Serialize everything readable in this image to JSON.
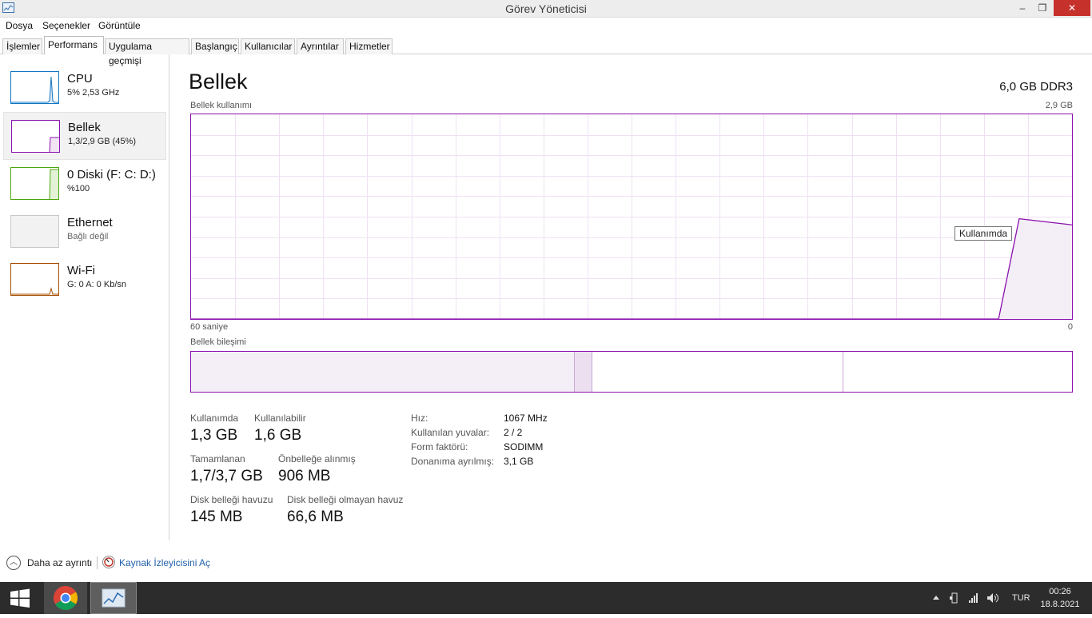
{
  "window": {
    "title": "Görev Yöneticisi",
    "controls": {
      "minimize": "–",
      "maximize": "❐",
      "close": "✕"
    }
  },
  "menu": [
    "Dosya",
    "Seçenekler",
    "Görüntüle"
  ],
  "tabs": [
    "İşlemler",
    "Performans",
    "Uygulama geçmişi",
    "Başlangıç",
    "Kullanıcılar",
    "Ayrıntılar",
    "Hizmetler"
  ],
  "active_tab": "Performans",
  "sidebar": [
    {
      "name": "CPU",
      "sub": "5%  2,53 GHz",
      "color": "#1176c2"
    },
    {
      "name": "Bellek",
      "sub": "1,3/2,9 GB (45%)",
      "color": "#8b12ae"
    },
    {
      "name": "0 Diski (F: C: D:)",
      "sub": "%100",
      "color": "#4da60c"
    },
    {
      "name": "Ethernet",
      "sub": "Bağlı değil",
      "color": "#a7a7a7"
    },
    {
      "name": "Wi-Fi",
      "sub": "G: 0  A: 0 Kb/sn",
      "color": "#a74f01"
    }
  ],
  "memory": {
    "title": "Bellek",
    "spec": "6,0 GB DDR3",
    "usage_label": "Bellek kullanımı",
    "usage_max": "2,9 GB",
    "x_left": "60 saniye",
    "x_right": "0",
    "tooltip": "Kullanımda",
    "composition_label": "Bellek bileşimi",
    "accent": "#8b12ae",
    "stats": [
      {
        "label": "Kullanımda",
        "value": "1,3 GB"
      },
      {
        "label": "Kullanılabilir",
        "value": "1,6 GB"
      },
      {
        "label": "Tamamlanan",
        "value": "1,7/3,7 GB"
      },
      {
        "label": "Önbelleğe alınmış",
        "value": "906 MB"
      },
      {
        "label": "Disk belleği havuzu",
        "value": "145 MB"
      },
      {
        "label": "Disk belleği olmayan havuz",
        "value": "66,6 MB"
      }
    ],
    "details": [
      {
        "key": "Hız:",
        "value": "1067 MHz"
      },
      {
        "key": "Kullanılan yuvalar:",
        "value": "2 / 2"
      },
      {
        "key": "Form faktörü:",
        "value": "SODIMM"
      },
      {
        "key": "Donanıma ayrılmış:",
        "value": "3,1 GB"
      }
    ]
  },
  "chart_data": {
    "type": "area",
    "title": "Bellek kullanımı",
    "xlabel": "",
    "ylabel": "",
    "x": [
      60,
      5,
      3.6,
      0
    ],
    "y_fraction": [
      0,
      0,
      0.49,
      0.46
    ],
    "xlim": [
      60,
      0
    ],
    "ylim": [
      0,
      2.9
    ],
    "grid": true,
    "series": [
      {
        "name": "Kullanımda",
        "values": [
          0,
          0,
          1.42,
          1.33
        ]
      }
    ]
  },
  "composition": {
    "in_use_fraction": 0.436,
    "modified_fraction": 0.02,
    "standby_end_fraction": 0.74
  },
  "footer": {
    "less_details": "Daha az ayrıntı",
    "resource_monitor": "Kaynak İzleyicisini Aç"
  },
  "taskbar": {
    "language": "TUR",
    "time": "00:26",
    "date": "18.8.2021"
  }
}
